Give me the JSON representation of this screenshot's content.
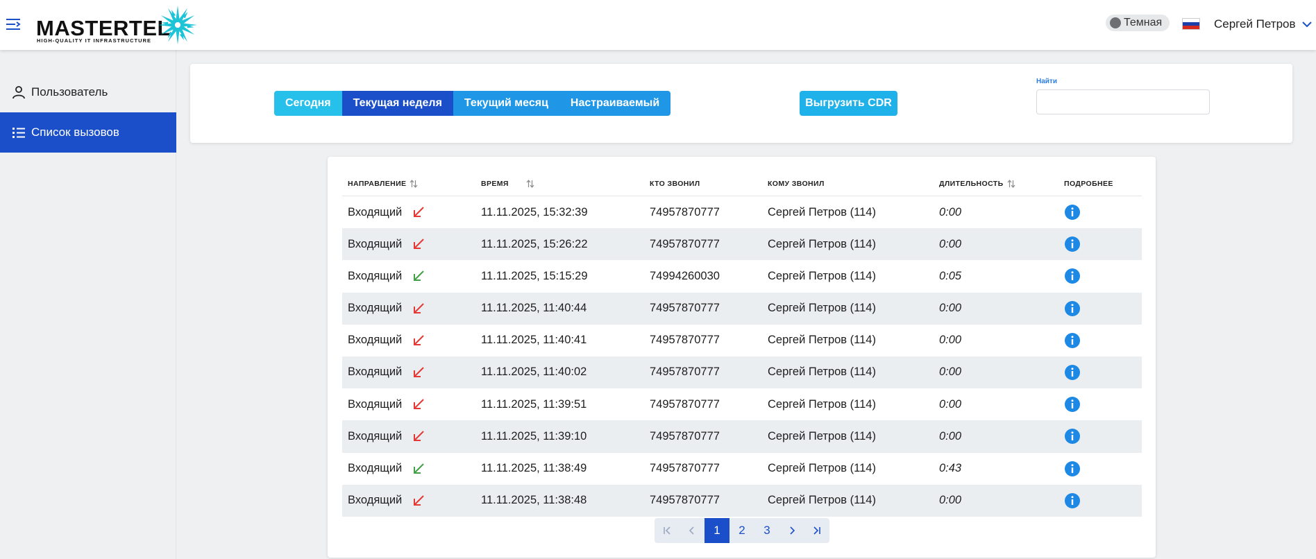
{
  "header": {
    "logo_text": "MASTERTEL",
    "logo_tagline": "HIGH-QUALITY IT INFRASTRUCTURE",
    "theme_label": "Темная",
    "user_name": "Сергей Петров"
  },
  "sidebar": {
    "items": [
      {
        "label": "Пользователь",
        "icon": "user-icon",
        "active": false
      },
      {
        "label": "Список вызовов",
        "icon": "list-icon",
        "active": true
      }
    ]
  },
  "filters": {
    "periods": [
      "Сегодня",
      "Текущая неделя",
      "Текущий месяц",
      "Настраиваемый"
    ],
    "selected_period": "Текущая неделя",
    "export_label": "Выгрузить CDR",
    "search_label": "Найти",
    "search_value": ""
  },
  "table": {
    "headers": {
      "direction": "Направление",
      "time": "Время",
      "caller": "Кто звонил",
      "callee": "Кому звонил",
      "duration": "Длительность",
      "details": "Подробнее"
    },
    "rows": [
      {
        "direction": "Входящий",
        "status": "missed",
        "time": "11.11.2025, 15:32:39",
        "caller": "74957870777",
        "callee": "Сергей Петров (114)",
        "duration": "0:00"
      },
      {
        "direction": "Входящий",
        "status": "missed",
        "time": "11.11.2025, 15:26:22",
        "caller": "74957870777",
        "callee": "Сергей Петров (114)",
        "duration": "0:00"
      },
      {
        "direction": "Входящий",
        "status": "answered",
        "time": "11.11.2025, 15:15:29",
        "caller": "74994260030",
        "callee": "Сергей Петров (114)",
        "duration": "0:05"
      },
      {
        "direction": "Входящий",
        "status": "missed",
        "time": "11.11.2025, 11:40:44",
        "caller": "74957870777",
        "callee": "Сергей Петров (114)",
        "duration": "0:00"
      },
      {
        "direction": "Входящий",
        "status": "missed",
        "time": "11.11.2025, 11:40:41",
        "caller": "74957870777",
        "callee": "Сергей Петров (114)",
        "duration": "0:00"
      },
      {
        "direction": "Входящий",
        "status": "missed",
        "time": "11.11.2025, 11:40:02",
        "caller": "74957870777",
        "callee": "Сергей Петров (114)",
        "duration": "0:00"
      },
      {
        "direction": "Входящий",
        "status": "missed",
        "time": "11.11.2025, 11:39:51",
        "caller": "74957870777",
        "callee": "Сергей Петров (114)",
        "duration": "0:00"
      },
      {
        "direction": "Входящий",
        "status": "missed",
        "time": "11.11.2025, 11:39:10",
        "caller": "74957870777",
        "callee": "Сергей Петров (114)",
        "duration": "0:00"
      },
      {
        "direction": "Входящий",
        "status": "answered",
        "time": "11.11.2025, 11:38:49",
        "caller": "74957870777",
        "callee": "Сергей Петров (114)",
        "duration": "0:43"
      },
      {
        "direction": "Входящий",
        "status": "missed",
        "time": "11.11.2025, 11:38:48",
        "caller": "74957870777",
        "callee": "Сергей Петров (114)",
        "duration": "0:00"
      }
    ]
  },
  "pagination": {
    "pages": [
      "1",
      "2",
      "3"
    ],
    "current": "1"
  },
  "colors": {
    "primary": "#1b4fc9",
    "accent": "#1f97e6",
    "cyan": "#27c0ea",
    "missed": "#e53935",
    "answered": "#43a047",
    "info": "#1e88e5"
  }
}
